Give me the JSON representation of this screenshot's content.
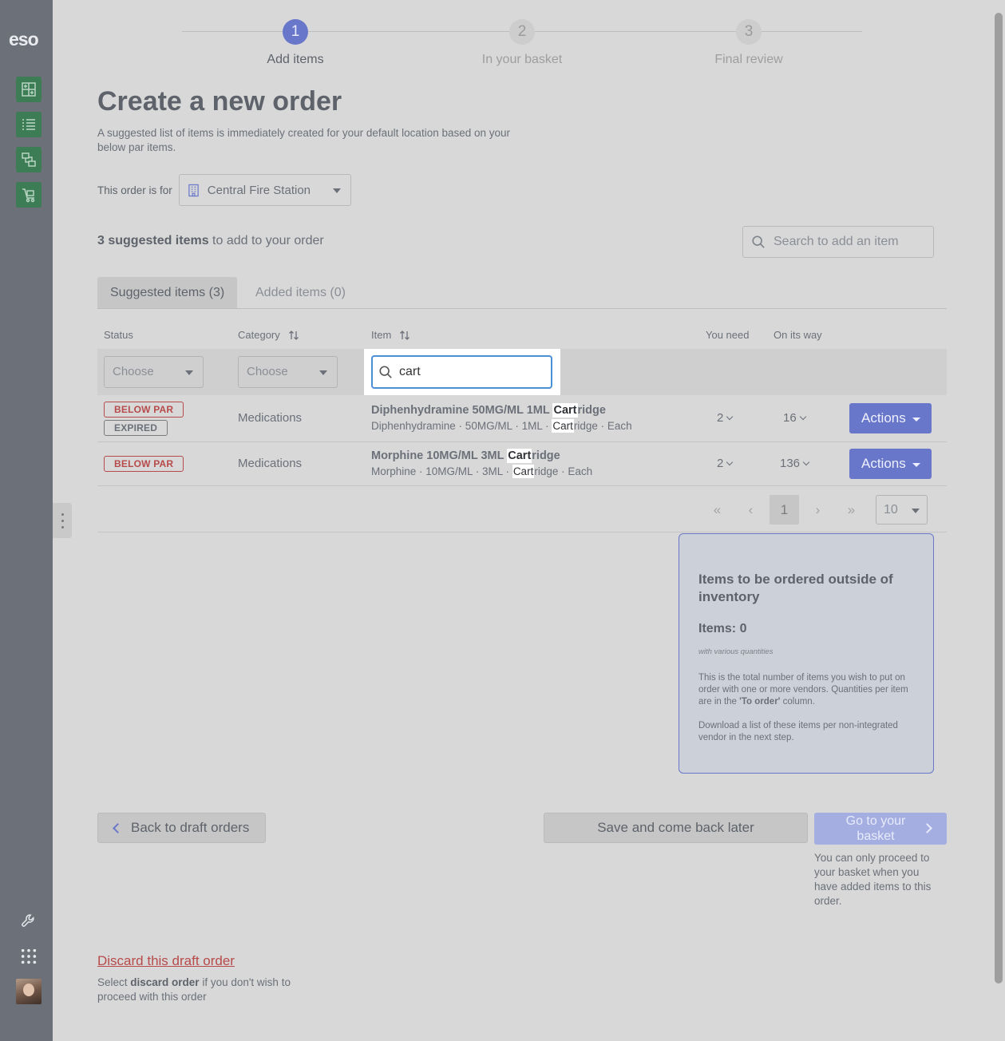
{
  "app": {
    "logo": "eso"
  },
  "stepper": {
    "steps": [
      {
        "number": "1",
        "label": "Add items"
      },
      {
        "number": "2",
        "label": "In your basket"
      },
      {
        "number": "3",
        "label": "Final review"
      }
    ],
    "active_step": 1
  },
  "header": {
    "title": "Create a new order",
    "intro": "A suggested list of items is immediately created for your default location based on your below par items."
  },
  "order_for": {
    "label": "This order is for",
    "location": "Central Fire Station"
  },
  "summary": {
    "count_bold": "3 suggested items",
    "count_rest": " to add to your order"
  },
  "search": {
    "placeholder": "Search to add an item"
  },
  "tabs": [
    {
      "label": "Suggested items (3)",
      "active": true
    },
    {
      "label": "Added items (0)",
      "active": false
    }
  ],
  "table": {
    "columns": {
      "status": "Status",
      "category": "Category",
      "item": "Item",
      "you_need": "You need",
      "on_its_way": "On its way"
    },
    "filters": {
      "status_placeholder": "Choose",
      "category_placeholder": "Choose",
      "item_value": "cart"
    },
    "rows": [
      {
        "badges": [
          "BELOW PAR",
          "EXPIRED"
        ],
        "category": "Medications",
        "name_pre": "Diphenhydramine 50MG/ML 1ML ",
        "name_hl": "Cart",
        "name_post": "ridge",
        "sub_pre": "Diphenhydramine · 50MG/ML · 1ML · ",
        "sub_hl": "Cart",
        "sub_post": "ridge · Each",
        "you_need": "2",
        "on_its_way": "16",
        "action": "Actions"
      },
      {
        "badges": [
          "BELOW PAR"
        ],
        "category": "Medications",
        "name_pre": "Morphine 10MG/ML 3ML ",
        "name_hl": "Cart",
        "name_post": "ridge",
        "sub_pre": "Morphine · 10MG/ML · 3ML · ",
        "sub_hl": "Cart",
        "sub_post": "ridge · Each",
        "you_need": "2",
        "on_its_way": "136",
        "action": "Actions"
      }
    ]
  },
  "pagination": {
    "first": "«",
    "prev": "‹",
    "current": "1",
    "next": "›",
    "last": "»",
    "per_page": "10"
  },
  "outside_card": {
    "title": "Items to be ordered outside of inventory",
    "count": "Items: 0",
    "note": "with various quantities",
    "p1_pre": "This is the total number of items you wish to put on order with one or more vendors. Quantities per item are in the ",
    "p1_bold": "'To order'",
    "p1_post": " column.",
    "p2": "Download a list of these items per non-integrated vendor in the next step."
  },
  "footer": {
    "back_label": "Back to draft orders",
    "save_label": "Save and come back later",
    "go_label": "Go to your basket",
    "go_note": "You can only proceed to your basket when you have added items to this order.",
    "discard_link": "Discard this draft order",
    "discard_pre": "Select ",
    "discard_bold": "discard order",
    "discard_post": " if you don't wish to proceed with this order"
  },
  "icons": {
    "sidebar": [
      "add-grid-icon",
      "list-icon",
      "transfer-icon",
      "cart-icon"
    ],
    "tools": [
      "wrench-icon",
      "apps-grid-icon"
    ],
    "search": "search-icon",
    "location": "building-icon",
    "sort": "sort-icon"
  },
  "colors": {
    "accent": "#6877c9",
    "sidebar": "#6b7079",
    "nav_green": "#3c7d56",
    "danger": "#b74a4a",
    "focus": "#4a90d9"
  }
}
